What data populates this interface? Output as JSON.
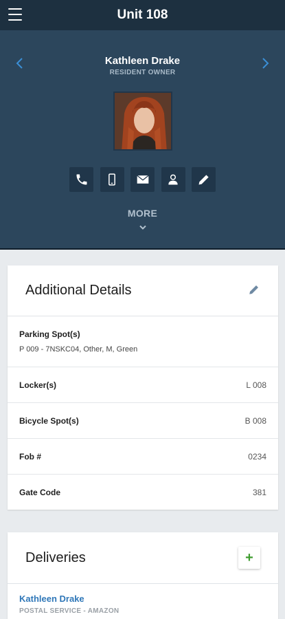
{
  "header": {
    "title": "Unit 108"
  },
  "profile": {
    "name": "Kathleen Drake",
    "role": "RESIDENT OWNER",
    "more_label": "MORE"
  },
  "actions": [
    {
      "icon": "phone-icon"
    },
    {
      "icon": "mobile-icon"
    },
    {
      "icon": "mail-icon"
    },
    {
      "icon": "contact-icon"
    },
    {
      "icon": "pencil-icon"
    }
  ],
  "additional_details": {
    "title": "Additional Details",
    "rows": [
      {
        "label": "Parking Spot(s)",
        "value": "P 009 - 7NSKC04, Other, M, Green"
      },
      {
        "label": "Locker(s)",
        "value": "L 008"
      },
      {
        "label": "Bicycle Spot(s)",
        "value": "B 008"
      },
      {
        "label": "Fob #",
        "value": "0234"
      },
      {
        "label": "Gate Code",
        "value": "381"
      }
    ]
  },
  "deliveries": {
    "title": "Deliveries",
    "add_label": "+",
    "items": [
      {
        "name": "Kathleen Drake",
        "service": "POSTAL SERVICE - AMAZON"
      }
    ]
  },
  "colors": {
    "top_bar": "#1d3040",
    "profile_bg": "#2c465c",
    "accent_green": "#3f9c2f",
    "link_blue": "#2f77b8"
  }
}
